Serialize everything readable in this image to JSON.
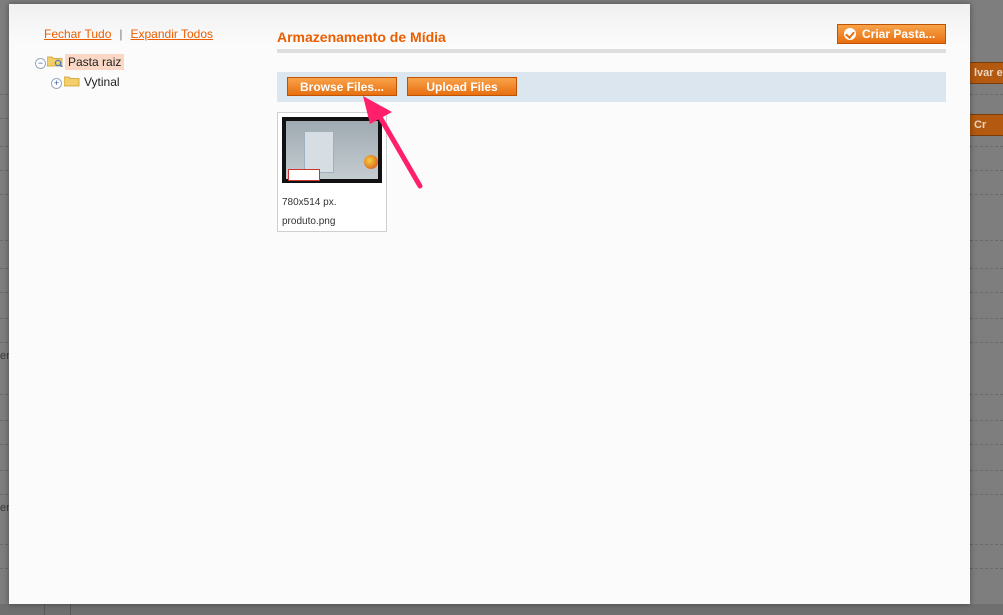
{
  "background": {
    "right_button_1": "lvar e",
    "right_button_2": "Cr",
    "left_fragment_1": "er",
    "left_fragment_2": "er"
  },
  "tree_panel": {
    "collapse_all": "Fechar Tudo",
    "separator": "|",
    "expand_all": "Expandir Todos",
    "nodes": [
      {
        "label": "Pasta raiz",
        "selected": true
      },
      {
        "label": "Vytinal",
        "selected": false
      }
    ]
  },
  "main": {
    "title": "Armazenamento de Mídia",
    "create_folder_label": "Criar Pasta...",
    "browse_files_label": "Browse Files...",
    "upload_files_label": "Upload Files",
    "file": {
      "dimensions": "780x514 px.",
      "name": "produto.png"
    }
  },
  "colors": {
    "accent": "#eb5e00",
    "button": "#f08a2a",
    "toolbar": "#dce6ee",
    "annotation": "#ff1f6b"
  }
}
